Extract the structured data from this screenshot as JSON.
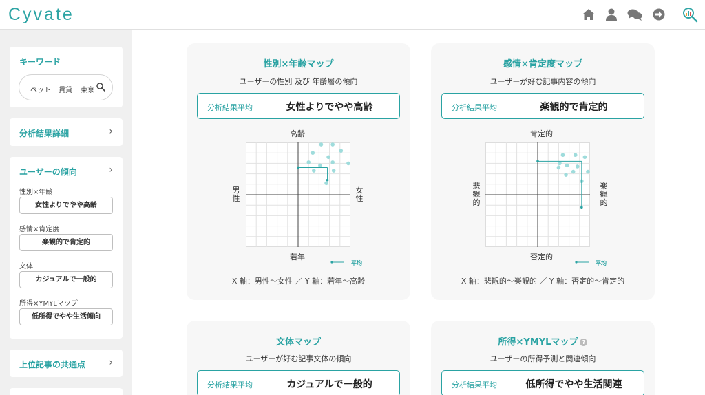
{
  "header": {
    "logo": "Cyvate",
    "icons": [
      "home-icon",
      "user-icon",
      "chat-icon",
      "logout-icon",
      "search-analysis-icon"
    ]
  },
  "sidebar": {
    "keyword_title": "キーワード",
    "keywords": [
      "ペット",
      "賃貸",
      "東京"
    ],
    "detail_link": "分析結果詳細",
    "tendency_title": "ユーザーの傾向",
    "tendencies": [
      {
        "label": "性別×年齢",
        "value": "女性よりでやや高齢"
      },
      {
        "label": "感情×肯定度",
        "value": "楽観的で肯定的"
      },
      {
        "label": "文体",
        "value": "カジュアルで一般的"
      },
      {
        "label": "所得×YMYLマップ",
        "value": "低所得でやや生活傾向"
      }
    ],
    "common_link": "上位記事の共通点"
  },
  "cards": {
    "gender_age": {
      "title": "性別×年齢マップ",
      "subtitle": "ユーザーの性別 及び 年齢層の傾向",
      "result_label": "分析結果平均",
      "result_value": "女性よりでやや高齢",
      "top": "高齢",
      "bottom": "若年",
      "left": "男性",
      "right": "女性",
      "legend": "平均",
      "caption": "X 軸：男性〜女性 ／ Y 軸：若年〜高齢"
    },
    "emotion": {
      "title": "感情×肯定度マップ",
      "subtitle": "ユーザーが好む記事内容の傾向",
      "result_label": "分析結果平均",
      "result_value": "楽観的で肯定的",
      "top": "肯定的",
      "bottom": "否定的",
      "left": "悲観的",
      "right": "楽観的",
      "legend": "平均",
      "caption": "X 軸：悲観的〜楽観的 ／ Y 軸：否定的〜肯定的"
    },
    "style": {
      "title": "文体マップ",
      "subtitle": "ユーザーが好む記事文体の傾向",
      "result_label": "分析結果平均",
      "result_value": "カジュアルで一般的"
    },
    "income": {
      "title": "所得×YMYLマップ",
      "subtitle": "ユーザーの所得予測と関連傾向",
      "result_label": "分析結果平均",
      "result_value": "低所得でやや生活関連"
    }
  },
  "chart_data": [
    {
      "type": "scatter",
      "xlabel": "男性〜女性",
      "ylabel": "若年〜高齢",
      "xlim": [
        -5,
        5
      ],
      "ylim": [
        -5,
        5
      ],
      "grid": true,
      "points": [
        [
          2.2,
          4.8
        ],
        [
          3.3,
          4.8
        ],
        [
          4.1,
          4.2
        ],
        [
          1.4,
          4.0
        ],
        [
          2.9,
          3.6
        ],
        [
          1.0,
          3.1
        ],
        [
          3.3,
          3.1
        ],
        [
          4.8,
          3.0
        ],
        [
          2.1,
          2.8
        ],
        [
          3.4,
          2.3
        ],
        [
          1.5,
          2.3
        ],
        [
          2.7,
          1.1
        ]
      ],
      "average": [
        2.8,
        2.6
      ],
      "legend": "平均"
    },
    {
      "type": "scatter",
      "xlabel": "悲観的〜楽観的",
      "ylabel": "否定的〜肯定的",
      "xlim": [
        -5,
        5
      ],
      "ylim": [
        -5,
        5
      ],
      "grid": true,
      "points": [
        [
          2.4,
          3.8
        ],
        [
          3.6,
          3.8
        ],
        [
          4.5,
          3.6
        ],
        [
          2.1,
          3.0
        ],
        [
          2.8,
          2.8
        ],
        [
          3.8,
          2.7
        ],
        [
          3.4,
          2.2
        ],
        [
          4.8,
          2.2
        ],
        [
          2.7,
          1.9
        ],
        [
          4.2,
          1.3
        ],
        [
          2.0,
          2.6
        ]
      ],
      "average": [
        4.2,
        3.2
      ],
      "average_tail": -1.2,
      "legend": "平均"
    }
  ]
}
